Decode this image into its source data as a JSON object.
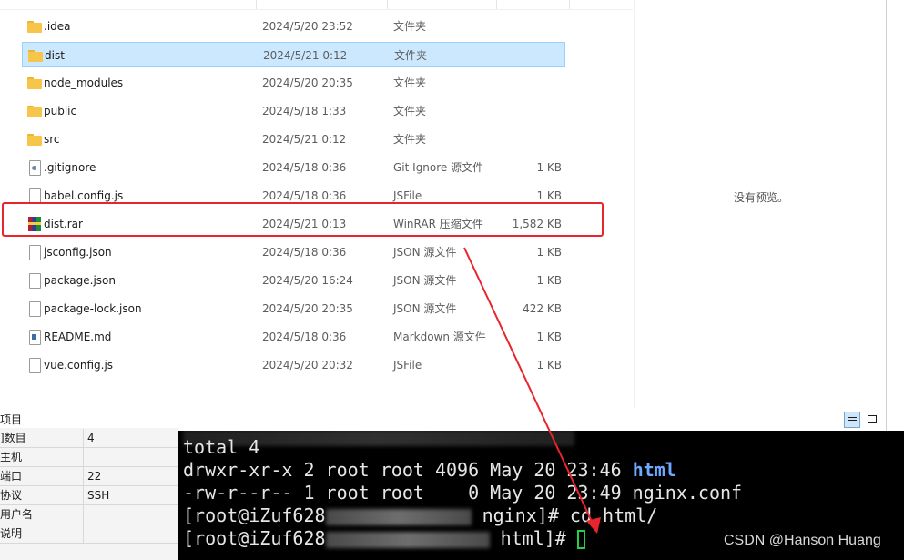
{
  "explorer": {
    "files": [
      {
        "name": ".idea",
        "date": "2024/5/20 23:52",
        "type": "文件夹",
        "size": "",
        "icon": "folder-icon",
        "selected": false
      },
      {
        "name": "dist",
        "date": "2024/5/21 0:12",
        "type": "文件夹",
        "size": "",
        "icon": "folder-icon",
        "selected": true
      },
      {
        "name": "node_modules",
        "date": "2024/5/20 20:35",
        "type": "文件夹",
        "size": "",
        "icon": "folder-icon",
        "selected": false
      },
      {
        "name": "public",
        "date": "2024/5/18 1:33",
        "type": "文件夹",
        "size": "",
        "icon": "folder-icon",
        "selected": false
      },
      {
        "name": "src",
        "date": "2024/5/21 0:12",
        "type": "文件夹",
        "size": "",
        "icon": "folder-icon",
        "selected": false
      },
      {
        "name": ".gitignore",
        "date": "2024/5/18 0:36",
        "type": "Git Ignore 源文件",
        "size": "1 KB",
        "icon": "gear-document-icon",
        "selected": false
      },
      {
        "name": "babel.config.js",
        "date": "2024/5/18 0:36",
        "type": "JSFile",
        "size": "1 KB",
        "icon": "document-icon",
        "selected": false
      },
      {
        "name": "dist.rar",
        "date": "2024/5/21 0:13",
        "type": "WinRAR 压缩文件",
        "size": "1,582 KB",
        "icon": "winrar-archive-icon",
        "selected": false
      },
      {
        "name": "jsconfig.json",
        "date": "2024/5/18 0:36",
        "type": "JSON 源文件",
        "size": "1 KB",
        "icon": "document-icon",
        "selected": false
      },
      {
        "name": "package.json",
        "date": "2024/5/20 16:24",
        "type": "JSON 源文件",
        "size": "1 KB",
        "icon": "document-icon",
        "selected": false
      },
      {
        "name": "package-lock.json",
        "date": "2024/5/20 20:35",
        "type": "JSON 源文件",
        "size": "422 KB",
        "icon": "document-icon",
        "selected": false
      },
      {
        "name": "README.md",
        "date": "2024/5/18 0:36",
        "type": "Markdown 源文件",
        "size": "1 KB",
        "icon": "markdown-document-icon",
        "selected": false
      },
      {
        "name": "vue.config.js",
        "date": "2024/5/20 20:32",
        "type": "JSFile",
        "size": "1 KB",
        "icon": "document-icon",
        "selected": false
      }
    ],
    "preview_text": "没有预览。",
    "highlight_color": "#e8242c"
  },
  "properties": {
    "title": "项目",
    "rows": [
      {
        "key": "]数目",
        "value": "4"
      },
      {
        "key": "主机",
        "value": ""
      },
      {
        "key": "端口",
        "value": "22"
      },
      {
        "key": "协议",
        "value": "SSH"
      },
      {
        "key": "用户名",
        "value": ""
      },
      {
        "key": "说明",
        "value": ""
      }
    ]
  },
  "terminal": {
    "line_total": "total 4",
    "line_html_perm": "drwxr-xr-x 2 root root 4096 May 20 23:46 ",
    "line_html_name": "html",
    "line_nginx": "-rw-r--r-- 1 root root    0 May 20 23:49 nginx.conf",
    "prompt1_start": "[root@iZuf628",
    "prompt1_end": " nginx]# cd html/",
    "prompt2_start": "[root@iZuf628",
    "prompt2_end": " html]# ",
    "cursor_color": "#22d046",
    "dir_color": "#6fa8ff"
  },
  "watermark": "CSDN @Hanson Huang"
}
